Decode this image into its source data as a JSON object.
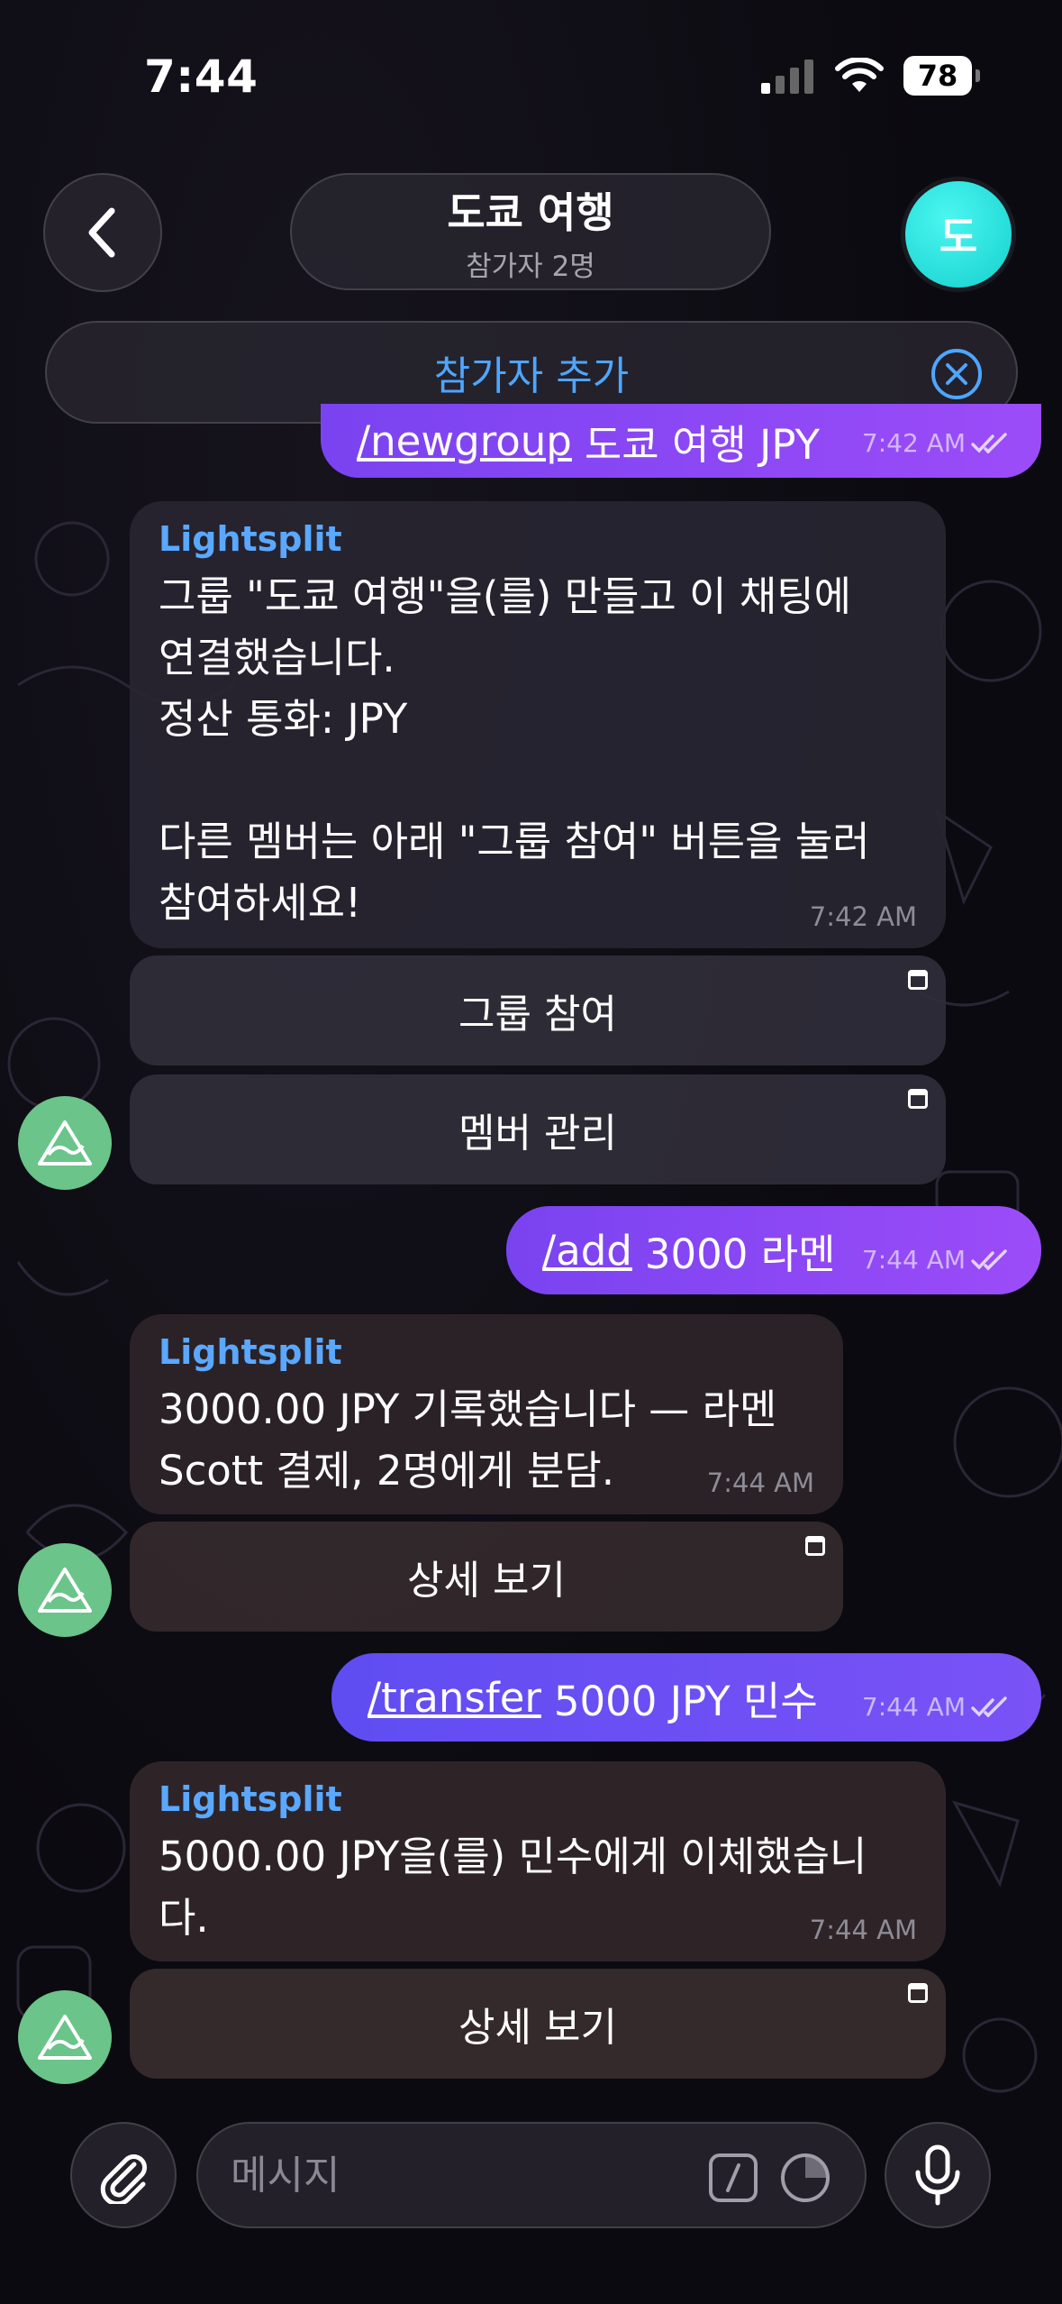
{
  "status_bar": {
    "time": "7:44",
    "battery": "78"
  },
  "header": {
    "title": "도쿄 여행",
    "subtitle": "참가자 2명",
    "avatar_letter": "도",
    "avatar_color": "#1fd9d6"
  },
  "add_participant": {
    "label": "참가자 추가",
    "color": "#4ea6ff"
  },
  "messages": [
    {
      "cmd": "/newgroup",
      "rest": "도쿄 여행 JPY",
      "time": "7:42 AM"
    },
    {
      "sender": "Lightsplit",
      "text": "그룹 \"도쿄 여행\"을(를) 만들고 이 채팅에\n연결했습니다.\n정산 통화: JPY\n\n다른 멤버는 아래 \"그룹 참여\" 버튼을 눌러\n참여하세요!",
      "time": "7:42 AM",
      "buttons": [
        "그룹 참여",
        "멤버 관리"
      ]
    },
    {
      "cmd": "/add",
      "rest": "3000 라멘",
      "time": "7:44 AM"
    },
    {
      "sender": "Lightsplit",
      "text": "3000.00 JPY 기록했습니다 — 라멘\nScott 결제, 2명에게 분담.",
      "time": "7:44 AM",
      "buttons": [
        "상세 보기"
      ]
    },
    {
      "cmd": "/transfer",
      "rest": "5000 JPY 민수",
      "time": "7:44 AM"
    },
    {
      "sender": "Lightsplit",
      "text": "5000.00 JPY을(를) 민수에게 이체했습니\n다.",
      "time": "7:44 AM",
      "buttons": [
        "상세 보기"
      ]
    }
  ],
  "input": {
    "placeholder": "메시지"
  },
  "colors": {
    "outgoing": "#8a48f4",
    "incoming": "#272530",
    "bot_avatar": "#6bc48a",
    "sender": "#5aa8ff"
  },
  "icons": [
    "back-icon",
    "close-circle-icon",
    "read-check-icon",
    "inline-button-corner-icon",
    "bot-logo-icon",
    "attach-icon",
    "slash-command-icon",
    "sticker-icon",
    "microphone-icon",
    "signal-icon",
    "wifi-icon"
  ]
}
